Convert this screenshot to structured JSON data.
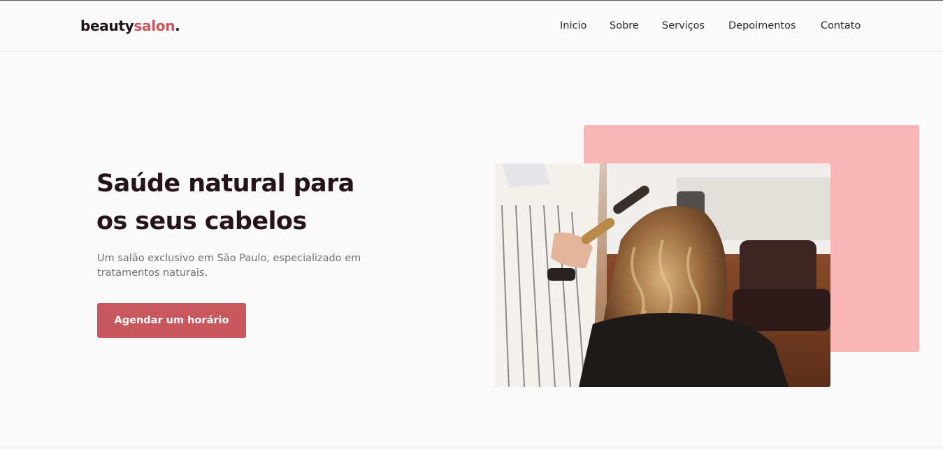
{
  "brand": {
    "part1": "beauty",
    "part2": "salon",
    "part3": "."
  },
  "nav": {
    "items": [
      {
        "label": "Inicio"
      },
      {
        "label": "Sobre"
      },
      {
        "label": "Serviços"
      },
      {
        "label": "Depoimentos"
      },
      {
        "label": "Contato"
      }
    ]
  },
  "hero": {
    "title": "Saúde natural para os seus cabelos",
    "subtitle": "Um salão exclusivo em São Paulo, especializado em tratamentos naturais.",
    "cta_label": "Agendar um horário"
  },
  "colors": {
    "accent": "#c8585e",
    "accent_light": "#fbb6b8",
    "heading": "#25141a",
    "text_muted": "#707070"
  }
}
